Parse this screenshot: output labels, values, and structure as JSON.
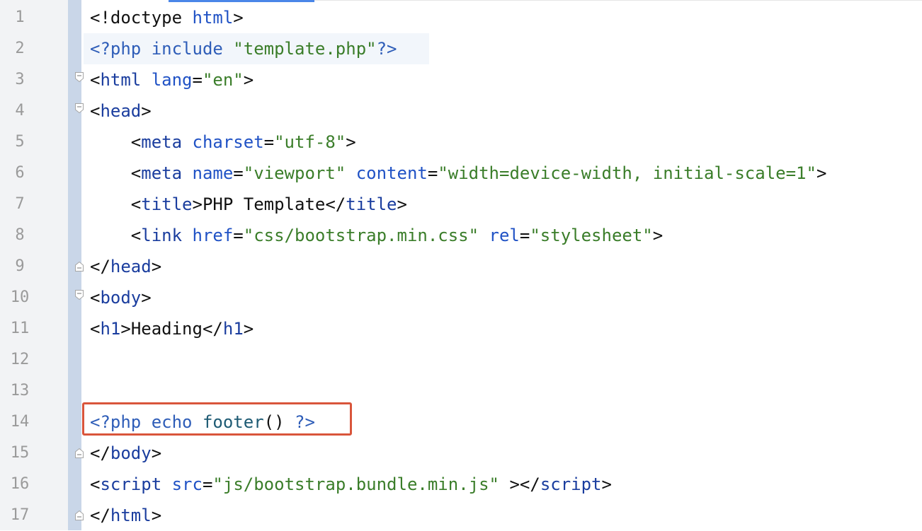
{
  "editor": {
    "lines": [
      {
        "num": "1",
        "tokens": [
          [
            "punct",
            "<!doctype "
          ],
          [
            "attr",
            "html"
          ],
          [
            "punct",
            ">"
          ]
        ]
      },
      {
        "num": "2",
        "tokens": [
          [
            "php",
            "<?php "
          ],
          [
            "php",
            "include "
          ],
          [
            "str",
            "\"template.php\""
          ],
          [
            "php",
            "?>"
          ]
        ]
      },
      {
        "num": "3",
        "fold": "open",
        "tokens": [
          [
            "punct",
            "<"
          ],
          [
            "tag",
            "html "
          ],
          [
            "attr",
            "lang"
          ],
          [
            "punct",
            "="
          ],
          [
            "str",
            "\"en\""
          ],
          [
            "punct",
            ">"
          ]
        ]
      },
      {
        "num": "4",
        "fold": "open",
        "tokens": [
          [
            "punct",
            "<"
          ],
          [
            "tag",
            "head"
          ],
          [
            "punct",
            ">"
          ]
        ]
      },
      {
        "num": "5",
        "tokens": [
          [
            "punct",
            "    <"
          ],
          [
            "tag",
            "meta "
          ],
          [
            "attr",
            "charset"
          ],
          [
            "punct",
            "="
          ],
          [
            "str",
            "\"utf-8\""
          ],
          [
            "punct",
            ">"
          ]
        ]
      },
      {
        "num": "6",
        "tokens": [
          [
            "punct",
            "    <"
          ],
          [
            "tag",
            "meta "
          ],
          [
            "attr",
            "name"
          ],
          [
            "punct",
            "="
          ],
          [
            "str",
            "\"viewport\" "
          ],
          [
            "attr",
            "content"
          ],
          [
            "punct",
            "="
          ],
          [
            "str",
            "\"width=device-width, initial-scale=1\""
          ],
          [
            "punct",
            ">"
          ]
        ]
      },
      {
        "num": "7",
        "tokens": [
          [
            "punct",
            "    <"
          ],
          [
            "tag",
            "title"
          ],
          [
            "punct",
            ">"
          ],
          [
            "text",
            "PHP Template"
          ],
          [
            "punct",
            "</"
          ],
          [
            "tag",
            "title"
          ],
          [
            "punct",
            ">"
          ]
        ]
      },
      {
        "num": "8",
        "tokens": [
          [
            "punct",
            "    <"
          ],
          [
            "tag",
            "link "
          ],
          [
            "attr",
            "href"
          ],
          [
            "punct",
            "="
          ],
          [
            "str",
            "\"css/bootstrap.min.css\" "
          ],
          [
            "attr",
            "rel"
          ],
          [
            "punct",
            "="
          ],
          [
            "str",
            "\"stylesheet\""
          ],
          [
            "punct",
            ">"
          ]
        ]
      },
      {
        "num": "9",
        "fold": "close",
        "tokens": [
          [
            "punct",
            "</"
          ],
          [
            "tag",
            "head"
          ],
          [
            "punct",
            ">"
          ]
        ]
      },
      {
        "num": "10",
        "fold": "open",
        "tokens": [
          [
            "punct",
            "<"
          ],
          [
            "tag",
            "body"
          ],
          [
            "punct",
            ">"
          ]
        ]
      },
      {
        "num": "11",
        "tokens": [
          [
            "punct",
            "<"
          ],
          [
            "tag",
            "h1"
          ],
          [
            "punct",
            ">"
          ],
          [
            "text",
            "Heading"
          ],
          [
            "punct",
            "</"
          ],
          [
            "tag",
            "h1"
          ],
          [
            "punct",
            ">"
          ]
        ]
      },
      {
        "num": "12",
        "tokens": []
      },
      {
        "num": "13",
        "tokens": []
      },
      {
        "num": "14",
        "tokens": [
          [
            "php",
            "<?php "
          ],
          [
            "php",
            "echo "
          ],
          [
            "fn",
            "footer"
          ],
          [
            "punct",
            "() "
          ],
          [
            "php",
            "?>"
          ]
        ]
      },
      {
        "num": "15",
        "fold": "close",
        "tokens": [
          [
            "punct",
            "</"
          ],
          [
            "tag",
            "body"
          ],
          [
            "punct",
            ">"
          ]
        ]
      },
      {
        "num": "16",
        "tokens": [
          [
            "punct",
            "<"
          ],
          [
            "tag",
            "script "
          ],
          [
            "attr",
            "src"
          ],
          [
            "punct",
            "="
          ],
          [
            "str",
            "\"js/bootstrap.bundle.min.js\" "
          ],
          [
            "punct",
            "></"
          ],
          [
            "tag",
            "script"
          ],
          [
            "punct",
            ">"
          ]
        ]
      },
      {
        "num": "17",
        "fold": "close",
        "tokens": [
          [
            "punct",
            "</"
          ],
          [
            "tag",
            "html"
          ],
          [
            "punct",
            ">"
          ]
        ]
      }
    ]
  },
  "colors": {
    "highlight_border": "#d9553b",
    "gutter_background": "#f2f3f5",
    "change_bar": "#c9d6e8"
  }
}
